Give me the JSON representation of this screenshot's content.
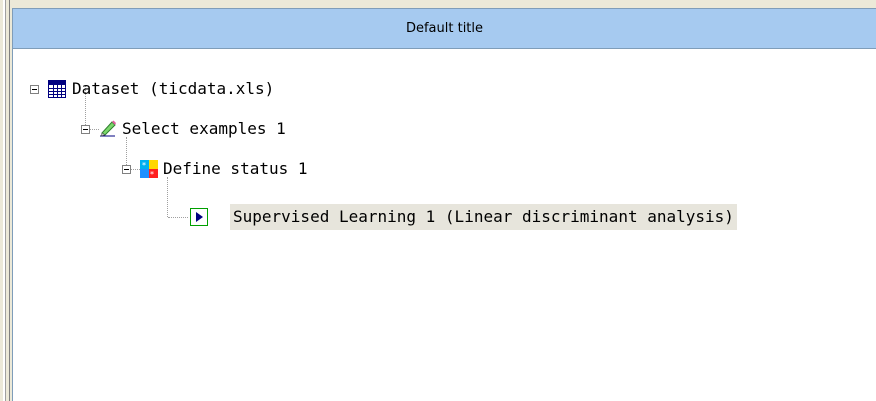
{
  "panel": {
    "title": "Default title"
  },
  "tree": {
    "nodes": [
      {
        "label": "Dataset (ticdata.xls)",
        "icon": "dataset-table-icon"
      },
      {
        "label": "Select examples 1",
        "icon": "pencil-select-icon"
      },
      {
        "label": "Define status 1",
        "icon": "define-status-icon"
      },
      {
        "label": "Supervised Learning 1 (Linear discriminant analysis)",
        "icon": "play-arrow-icon",
        "selected": true
      }
    ]
  },
  "colors": {
    "title_bar": "#a6caf0",
    "panel_bg": "#ffffff",
    "selection_bg": "#e7e5dc",
    "play_icon_border": "#00a000",
    "play_icon_arrow": "#000080"
  }
}
